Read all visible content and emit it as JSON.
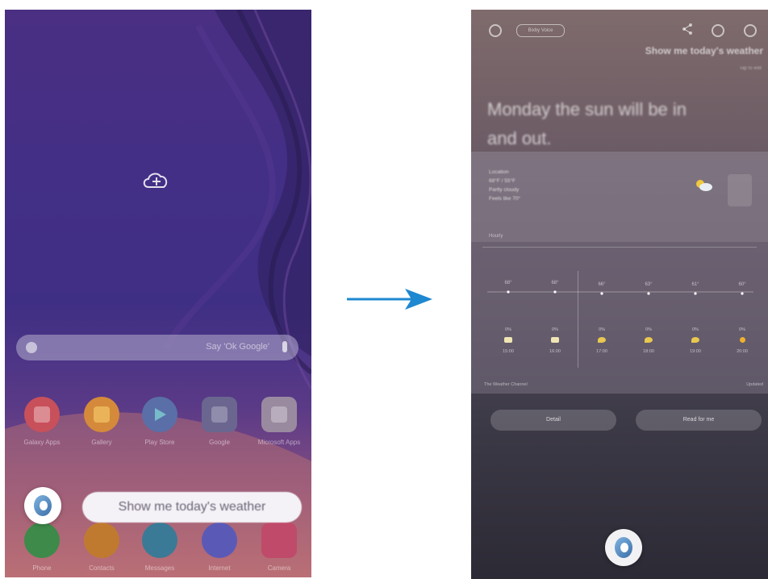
{
  "colors": {
    "arrow": "#1e88d0",
    "wallpaper_top": "#4a2f83",
    "wallpaper_bottom": "#b56a78",
    "result_bg_top": "#7f6b6c",
    "result_bg_bottom": "#2c2a35"
  },
  "home": {
    "search_hint": "Say 'Ok Google'",
    "apps": [
      {
        "label": "Galaxy Apps",
        "icon": "galaxy-apps-icon",
        "color": "#c8505a"
      },
      {
        "label": "Gallery",
        "icon": "gallery-icon",
        "color": "#d48a3a"
      },
      {
        "label": "Play Store",
        "icon": "play-store-icon",
        "color": "#5a6fa8"
      },
      {
        "label": "Google",
        "icon": "google-folder-icon",
        "color": "#6a6690"
      },
      {
        "label": "Microsoft Apps",
        "icon": "microsoft-folder-icon",
        "color": "#9a8aa0"
      }
    ],
    "dock": [
      {
        "label": "Phone",
        "icon": "phone-icon",
        "color": "#3d8a4a"
      },
      {
        "label": "Contacts",
        "icon": "contacts-icon",
        "color": "#c07a30"
      },
      {
        "label": "Messages",
        "icon": "messages-icon",
        "color": "#3a7a96"
      },
      {
        "label": "Internet",
        "icon": "internet-icon",
        "color": "#5a5ab6"
      },
      {
        "label": "Camera",
        "icon": "camera-icon",
        "color": "#c04a6a"
      }
    ],
    "voice_bubble": "Show me today's weather"
  },
  "bixby": {
    "status_pill": "Bixby Voice",
    "query": "Show me today's weather",
    "subquery": "Tap to edit",
    "answer": "Monday the sun will be in and out.",
    "location_lines": [
      "Location",
      "68°F / 55°F",
      "Partly cloudy",
      "Feels like 70°"
    ],
    "today_label": "Hourly",
    "temps": [
      "68°",
      "68°",
      "66°",
      "63°",
      "61°",
      "60°"
    ],
    "hours": [
      {
        "pct": "0%",
        "time": "15:00",
        "sym": "#f0e6b4"
      },
      {
        "pct": "0%",
        "time": "16:00",
        "sym": "#f0e6b4"
      },
      {
        "pct": "0%",
        "time": "17:00",
        "sym": "#e8c850"
      },
      {
        "pct": "0%",
        "time": "18:00",
        "sym": "#e8c850"
      },
      {
        "pct": "0%",
        "time": "19:00",
        "sym": "#e8c850"
      },
      {
        "pct": "0%",
        "time": "20:00",
        "sym": "#f0b030"
      }
    ],
    "source": "The Weather Channel",
    "updated": "Updated",
    "chip_left": "Detail",
    "chip_right": "Read for me"
  }
}
